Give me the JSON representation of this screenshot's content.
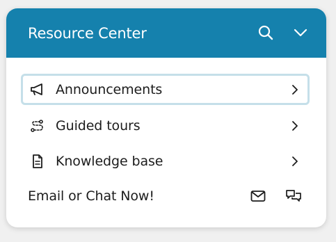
{
  "header": {
    "title": "Resource Center",
    "background": "#1581ad",
    "icons": [
      "search-icon",
      "chevron-down-icon"
    ]
  },
  "items": [
    {
      "label": "Announcements",
      "icon": "megaphone-icon",
      "focused": true
    },
    {
      "label": "Guided tours",
      "icon": "route-icon",
      "focused": false
    },
    {
      "label": "Knowledge base",
      "icon": "document-icon",
      "focused": false
    }
  ],
  "contact": {
    "label": "Email or Chat Now!",
    "icons": [
      "email-icon",
      "chat-icon"
    ]
  },
  "colors": {
    "accent": "#1581ad",
    "focus_ring": "#c5dfe9",
    "text": "#1c1c1c"
  }
}
